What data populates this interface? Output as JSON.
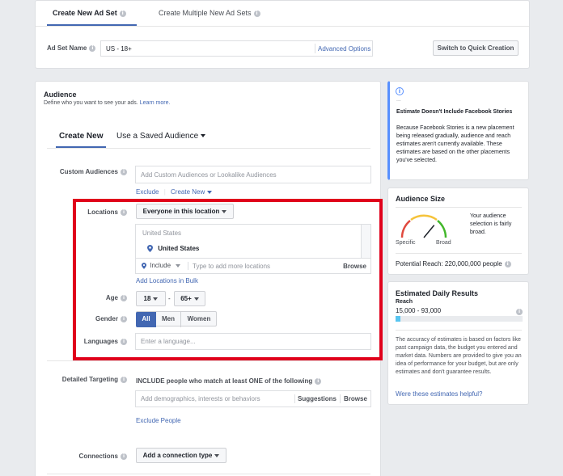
{
  "tabs": {
    "create_new": "Create New Ad Set",
    "create_multiple": "Create Multiple New Ad Sets"
  },
  "adset": {
    "name_label": "Ad Set Name",
    "name_value": "US - 18+",
    "advanced_options": "Advanced Options",
    "quick_creation": "Switch to Quick Creation"
  },
  "audience": {
    "title": "Audience",
    "subtitle": "Define who you want to see your ads.",
    "learn_more": "Learn more.",
    "tab_create_new": "Create New",
    "tab_saved": "Use a Saved Audience",
    "custom_audiences_label": "Custom Audiences",
    "custom_audiences_placeholder": "Add Custom Audiences or Lookalike Audiences",
    "exclude": "Exclude",
    "create_new": "Create New",
    "locations_label": "Locations",
    "locations_dropdown": "Everyone in this location",
    "location_country_header": "United States",
    "location_selected": "United States",
    "include": "Include",
    "location_placeholder": "Type to add more locations",
    "browse": "Browse",
    "add_bulk": "Add Locations in Bulk",
    "age_label": "Age",
    "age_min": "18",
    "age_dash": "-",
    "age_max": "65+",
    "gender_label": "Gender",
    "gender_options": [
      "All",
      "Men",
      "Women"
    ],
    "gender_selected": "All",
    "languages_label": "Languages",
    "languages_placeholder": "Enter a language...",
    "detailed_label": "Detailed Targeting",
    "detailed_include": "INCLUDE people who match at least ONE of the following",
    "detailed_placeholder": "Add demographics, interests or behaviors",
    "suggestions": "Suggestions",
    "detailed_browse": "Browse",
    "exclude_people": "Exclude People",
    "connections_label": "Connections",
    "connections_dropdown": "Add a connection type"
  },
  "notice": {
    "dots": "...",
    "title": "Estimate Doesn't Include Facebook Stories",
    "body": "Because Facebook Stories is a new placement being released gradually, audience and reach estimates aren't currently available. These estimates are based on the other placements you've selected."
  },
  "audience_size": {
    "title": "Audience Size",
    "description": "Your audience selection is fairly broad.",
    "specific": "Specific",
    "broad": "Broad",
    "potential_reach": "Potential Reach: 220,000,000 people",
    "gauge_level": 0.72,
    "colors": {
      "red": "#e04a3f",
      "yellow": "#f5c33b",
      "green": "#42b72a"
    }
  },
  "daily_results": {
    "title": "Estimated Daily Results",
    "reach_label": "Reach",
    "reach_range": "15,000 - 93,000",
    "reach_fill_fraction": 0.04,
    "accuracy_note": "The accuracy of estimates is based on factors like past campaign data, the budget you entered and market data. Numbers are provided to give you an idea of performance for your budget, but are only estimates and don't guarantee results.",
    "helpful_link": "Were these estimates helpful?"
  },
  "colors": {
    "highlight": "#e0001b",
    "facebook_blue": "#4267b2",
    "notice_accent": "#5890ff",
    "reach_bar": "#58c5f0"
  },
  "icons": [
    "info-icon",
    "location-pin-icon",
    "caret-down-icon",
    "notice-info-icon"
  ]
}
